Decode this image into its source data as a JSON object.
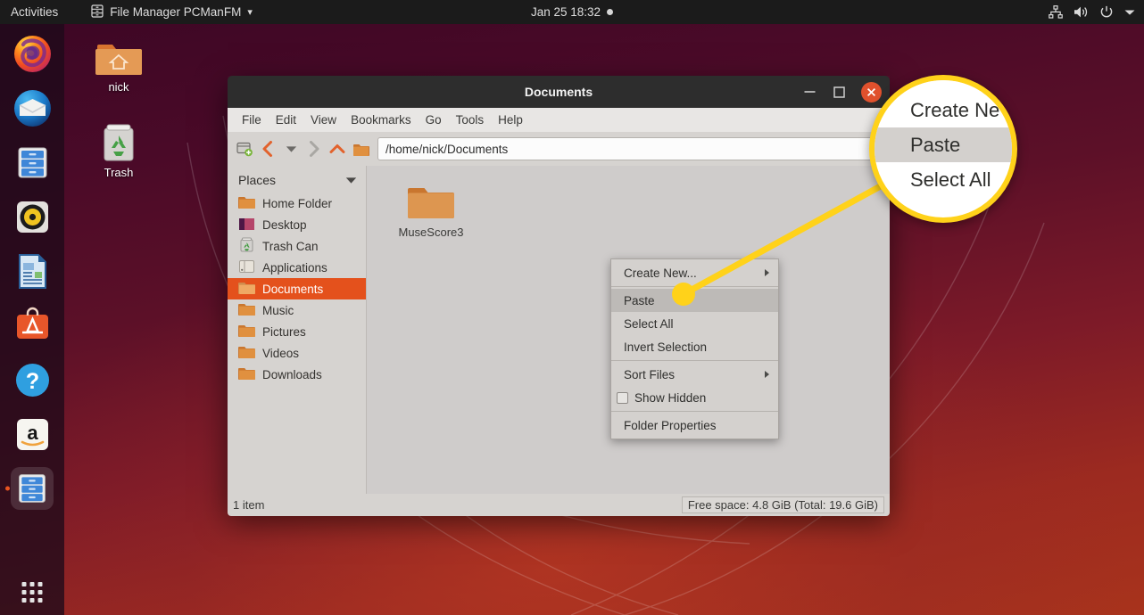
{
  "topbar": {
    "activities": "Activities",
    "app_menu": {
      "icon": "file-manager-icon",
      "label": "File Manager PCManFM",
      "arrow": "▾"
    },
    "clock": "Jan 25  18:32",
    "sys_icons": [
      "network-icon",
      "volume-icon",
      "power-icon",
      "chevron-down-icon"
    ]
  },
  "dock": {
    "items": [
      {
        "name": "firefox",
        "label": "Firefox",
        "active": false
      },
      {
        "name": "thunderbird",
        "label": "Thunderbird Mail",
        "active": false
      },
      {
        "name": "files",
        "label": "Files",
        "active": false
      },
      {
        "name": "rhythmbox",
        "label": "Rhythmbox",
        "active": false
      },
      {
        "name": "libreoffice-writer",
        "label": "LibreOffice Writer",
        "active": false
      },
      {
        "name": "ubuntu-software",
        "label": "Ubuntu Software",
        "active": false
      },
      {
        "name": "help",
        "label": "Help",
        "active": false
      },
      {
        "name": "amazon",
        "label": "Amazon",
        "active": false
      },
      {
        "name": "pcmanfm",
        "label": "File Manager PCManFM",
        "active": true
      }
    ],
    "show_apps_label": "Show Applications"
  },
  "desktop_icons": [
    {
      "name": "home-folder",
      "label": "nick"
    },
    {
      "name": "trash",
      "label": "Trash"
    }
  ],
  "window": {
    "title": "Documents",
    "buttons": {
      "minimize": "minimize-icon",
      "maximize": "maximize-icon",
      "close": "close-icon"
    },
    "menus": [
      "File",
      "Edit",
      "View",
      "Bookmarks",
      "Go",
      "Tools",
      "Help"
    ],
    "toolbar_icons": [
      "new-tab-icon",
      "back-icon",
      "history-dropdown-icon",
      "forward-icon",
      "up-icon",
      "home-icon"
    ],
    "path": "/home/nick/Documents",
    "sidebar": {
      "header": "Places",
      "items": [
        {
          "label": "Home Folder",
          "icon": "folder-icon",
          "selected": false
        },
        {
          "label": "Desktop",
          "icon": "desktop-icon",
          "selected": false
        },
        {
          "label": "Trash Can",
          "icon": "trash-icon",
          "selected": false
        },
        {
          "label": "Applications",
          "icon": "applications-icon",
          "selected": false
        },
        {
          "label": "Documents",
          "icon": "folder-icon",
          "selected": true
        },
        {
          "label": "Music",
          "icon": "folder-icon",
          "selected": false
        },
        {
          "label": "Pictures",
          "icon": "folder-icon",
          "selected": false
        },
        {
          "label": "Videos",
          "icon": "folder-icon",
          "selected": false
        },
        {
          "label": "Downloads",
          "icon": "folder-icon",
          "selected": false
        }
      ]
    },
    "files": [
      {
        "label": "MuseScore3",
        "icon": "folder-icon"
      }
    ],
    "status": {
      "item_count": "1 item",
      "free_space": "Free space: 4.8 GiB (Total: 19.6 GiB)"
    }
  },
  "context_menu": {
    "items": [
      {
        "label": "Create New...",
        "submenu": true,
        "checkbox": false,
        "highlighted": false
      },
      {
        "label": "Paste",
        "submenu": false,
        "checkbox": false,
        "highlighted": true
      },
      {
        "label": "Select All",
        "submenu": false,
        "checkbox": false,
        "highlighted": false
      },
      {
        "label": "Invert Selection",
        "submenu": false,
        "checkbox": false,
        "highlighted": false
      },
      {
        "label": "Sort Files",
        "submenu": true,
        "checkbox": false,
        "highlighted": false
      },
      {
        "label": "Show Hidden",
        "submenu": false,
        "checkbox": true,
        "highlighted": false
      },
      {
        "label": "Folder Properties",
        "submenu": false,
        "checkbox": false,
        "highlighted": false
      }
    ]
  },
  "magnifier": {
    "rows": [
      {
        "label": "Create Ne",
        "highlighted": false
      },
      {
        "label": "Paste",
        "highlighted": true
      },
      {
        "label": "Select All",
        "highlighted": false
      }
    ]
  },
  "colors": {
    "accent": "#e4511c",
    "highlight": "#ffd21a",
    "close_button": "#e0512d",
    "window_chrome": "#d6d3d0",
    "titlebar": "#2d2d2d",
    "topbar": "#1b1b1b"
  }
}
